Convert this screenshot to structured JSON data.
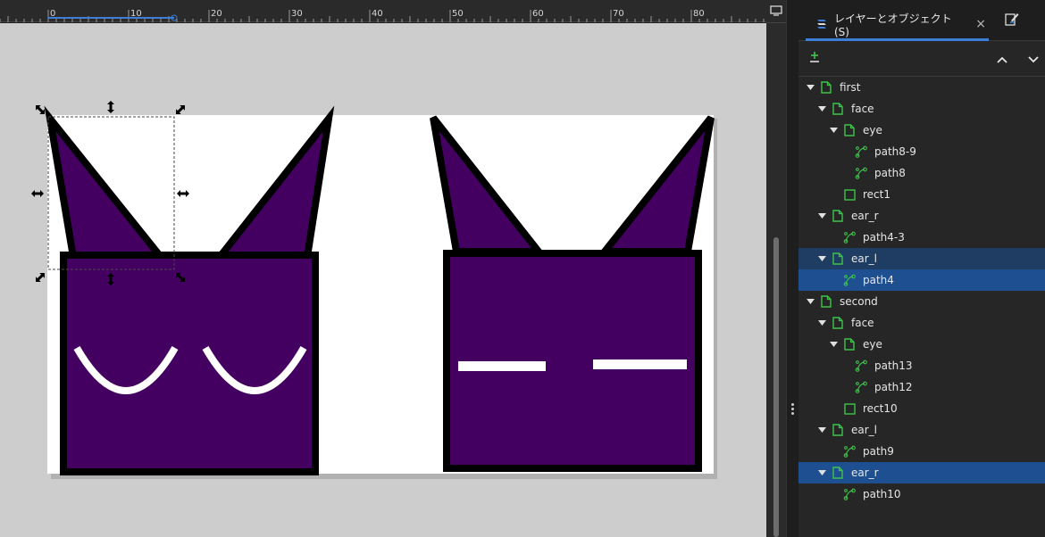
{
  "ruler": {
    "labels": [
      "0",
      "10",
      "20",
      "30",
      "40",
      "50",
      "60",
      "70",
      "80"
    ]
  },
  "panel": {
    "tab_label": "レイヤーとオブジェクト(S)",
    "tab_close": "×",
    "tab_icon": "layers-icon",
    "other_tab_icon": "pen-edit-icon",
    "toolbar_icons": [
      "add-layer-icon",
      "move-up-icon",
      "move-down-icon"
    ]
  },
  "tree": [
    {
      "label": "first",
      "depth": 0,
      "type": "layer",
      "expanded": true,
      "selected": ""
    },
    {
      "label": "face",
      "depth": 1,
      "type": "layer",
      "expanded": true,
      "selected": ""
    },
    {
      "label": "eye",
      "depth": 2,
      "type": "layer",
      "expanded": true,
      "selected": ""
    },
    {
      "label": "path8-9",
      "depth": 3,
      "type": "path",
      "selected": ""
    },
    {
      "label": "path8",
      "depth": 3,
      "type": "path",
      "selected": ""
    },
    {
      "label": "rect1",
      "depth": 2,
      "type": "rect",
      "selected": ""
    },
    {
      "label": "ear_r",
      "depth": 1,
      "type": "layer",
      "expanded": true,
      "selected": ""
    },
    {
      "label": "path4-3",
      "depth": 2,
      "type": "path",
      "selected": ""
    },
    {
      "label": "ear_l",
      "depth": 1,
      "type": "layer",
      "expanded": true,
      "selected": "dark"
    },
    {
      "label": "path4",
      "depth": 2,
      "type": "path",
      "selected": "blue"
    },
    {
      "label": "second",
      "depth": 0,
      "type": "layer",
      "expanded": true,
      "selected": ""
    },
    {
      "label": "face",
      "depth": 1,
      "type": "layer",
      "expanded": true,
      "selected": ""
    },
    {
      "label": "eye",
      "depth": 2,
      "type": "layer",
      "expanded": true,
      "selected": ""
    },
    {
      "label": "path13",
      "depth": 3,
      "type": "path",
      "selected": ""
    },
    {
      "label": "path12",
      "depth": 3,
      "type": "path",
      "selected": ""
    },
    {
      "label": "rect10",
      "depth": 2,
      "type": "rect",
      "selected": ""
    },
    {
      "label": "ear_l",
      "depth": 1,
      "type": "layer",
      "expanded": true,
      "selected": ""
    },
    {
      "label": "path9",
      "depth": 2,
      "type": "path",
      "selected": ""
    },
    {
      "label": "ear_r",
      "depth": 1,
      "type": "layer",
      "expanded": true,
      "selected": "blue"
    },
    {
      "label": "path10",
      "depth": 2,
      "type": "path",
      "selected": ""
    }
  ],
  "colors": {
    "fill_purple": "#440060",
    "stroke": "#000000",
    "eye_white": "#ffffff",
    "layer_icon_green": "#3fc34a",
    "selection_blue": "#1d4f91",
    "selection_dark": "#1f3c63",
    "accent": "#3d7fd6"
  }
}
